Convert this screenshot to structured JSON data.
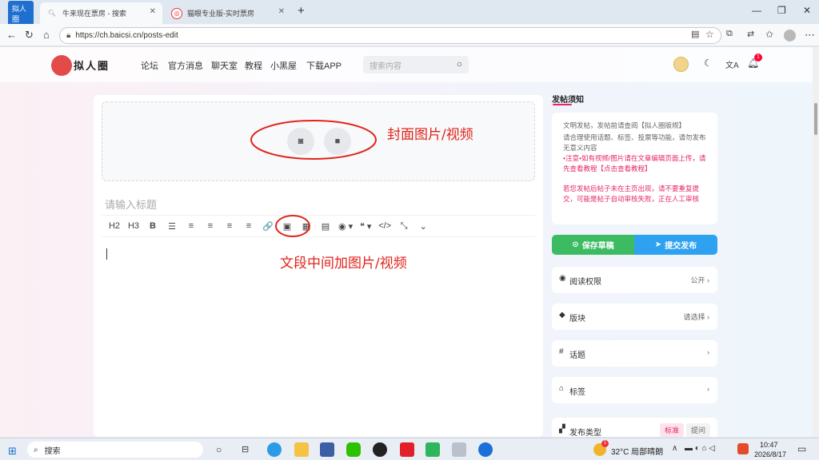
{
  "browser": {
    "tabs": [
      {
        "label": "拟人圈",
        "active": true
      },
      {
        "label": "牛来现在票房 - 搜索"
      },
      {
        "label": "猫眼专业版-实时票房"
      }
    ],
    "new_tab": "+",
    "url": "https://ch.baicsi.cn/posts-edit"
  },
  "site": {
    "logo_text": "拟人圈",
    "nav": [
      "论坛",
      "官方消息",
      "聊天室",
      "教程",
      "小黑屋",
      "下载APP"
    ],
    "search_placeholder": "搜索内容",
    "notif_count": "1"
  },
  "editor": {
    "title_placeholder": "请输入标题",
    "toolbar": [
      "H2",
      "H3",
      "B",
      "☰",
      "≡",
      "≡",
      "≡",
      "≡",
      "🔗",
      "▣",
      "▦",
      "▤",
      "◉ ▾",
      "❝ ▾",
      "</>",
      "⤡",
      "⌄"
    ]
  },
  "annotations": {
    "cover": "封面图片/视频",
    "inline": "文段中间加图片/视频"
  },
  "sidebar": {
    "notice_title": "发帖须知",
    "notice_p1": "文明发帖，发帖前请查阅【拟人圈版规】",
    "notice_p2": "请合理使用话题、标签、投票等功能，请勿发布无意义内容",
    "notice_p3": "•注意•如有视频/图片请在文章编辑页面上传，请先查看教程【点击查看教程】",
    "notice_p4": "若您发帖后帖子未在主页出现，请不要重复提交，可能是帖子自动审核失败，正在人工审核",
    "save_draft": "保存草稿",
    "submit": "提交发布",
    "rows": [
      {
        "icon": "eye-icon",
        "label": "阅读权限",
        "value": "公开"
      },
      {
        "icon": "cube-icon",
        "label": "版块",
        "value": "请选择"
      },
      {
        "icon": "hash-icon",
        "label": "话题",
        "value": ""
      },
      {
        "icon": "tag-icon",
        "label": "标签",
        "value": ""
      }
    ],
    "post_type_label": "发布类型",
    "post_type_opts": [
      "标准",
      "提问"
    ]
  },
  "taskbar": {
    "search": "搜索",
    "weather": "32°C  局部晴朗",
    "time": "10:47",
    "date": "2026/8/17",
    "weather_badge": "1"
  },
  "colors": {
    "accent_green": "#3dbb63",
    "accent_blue": "#2ea2f0",
    "accent_pink": "#e6266b",
    "annot_red": "#e0241b"
  }
}
